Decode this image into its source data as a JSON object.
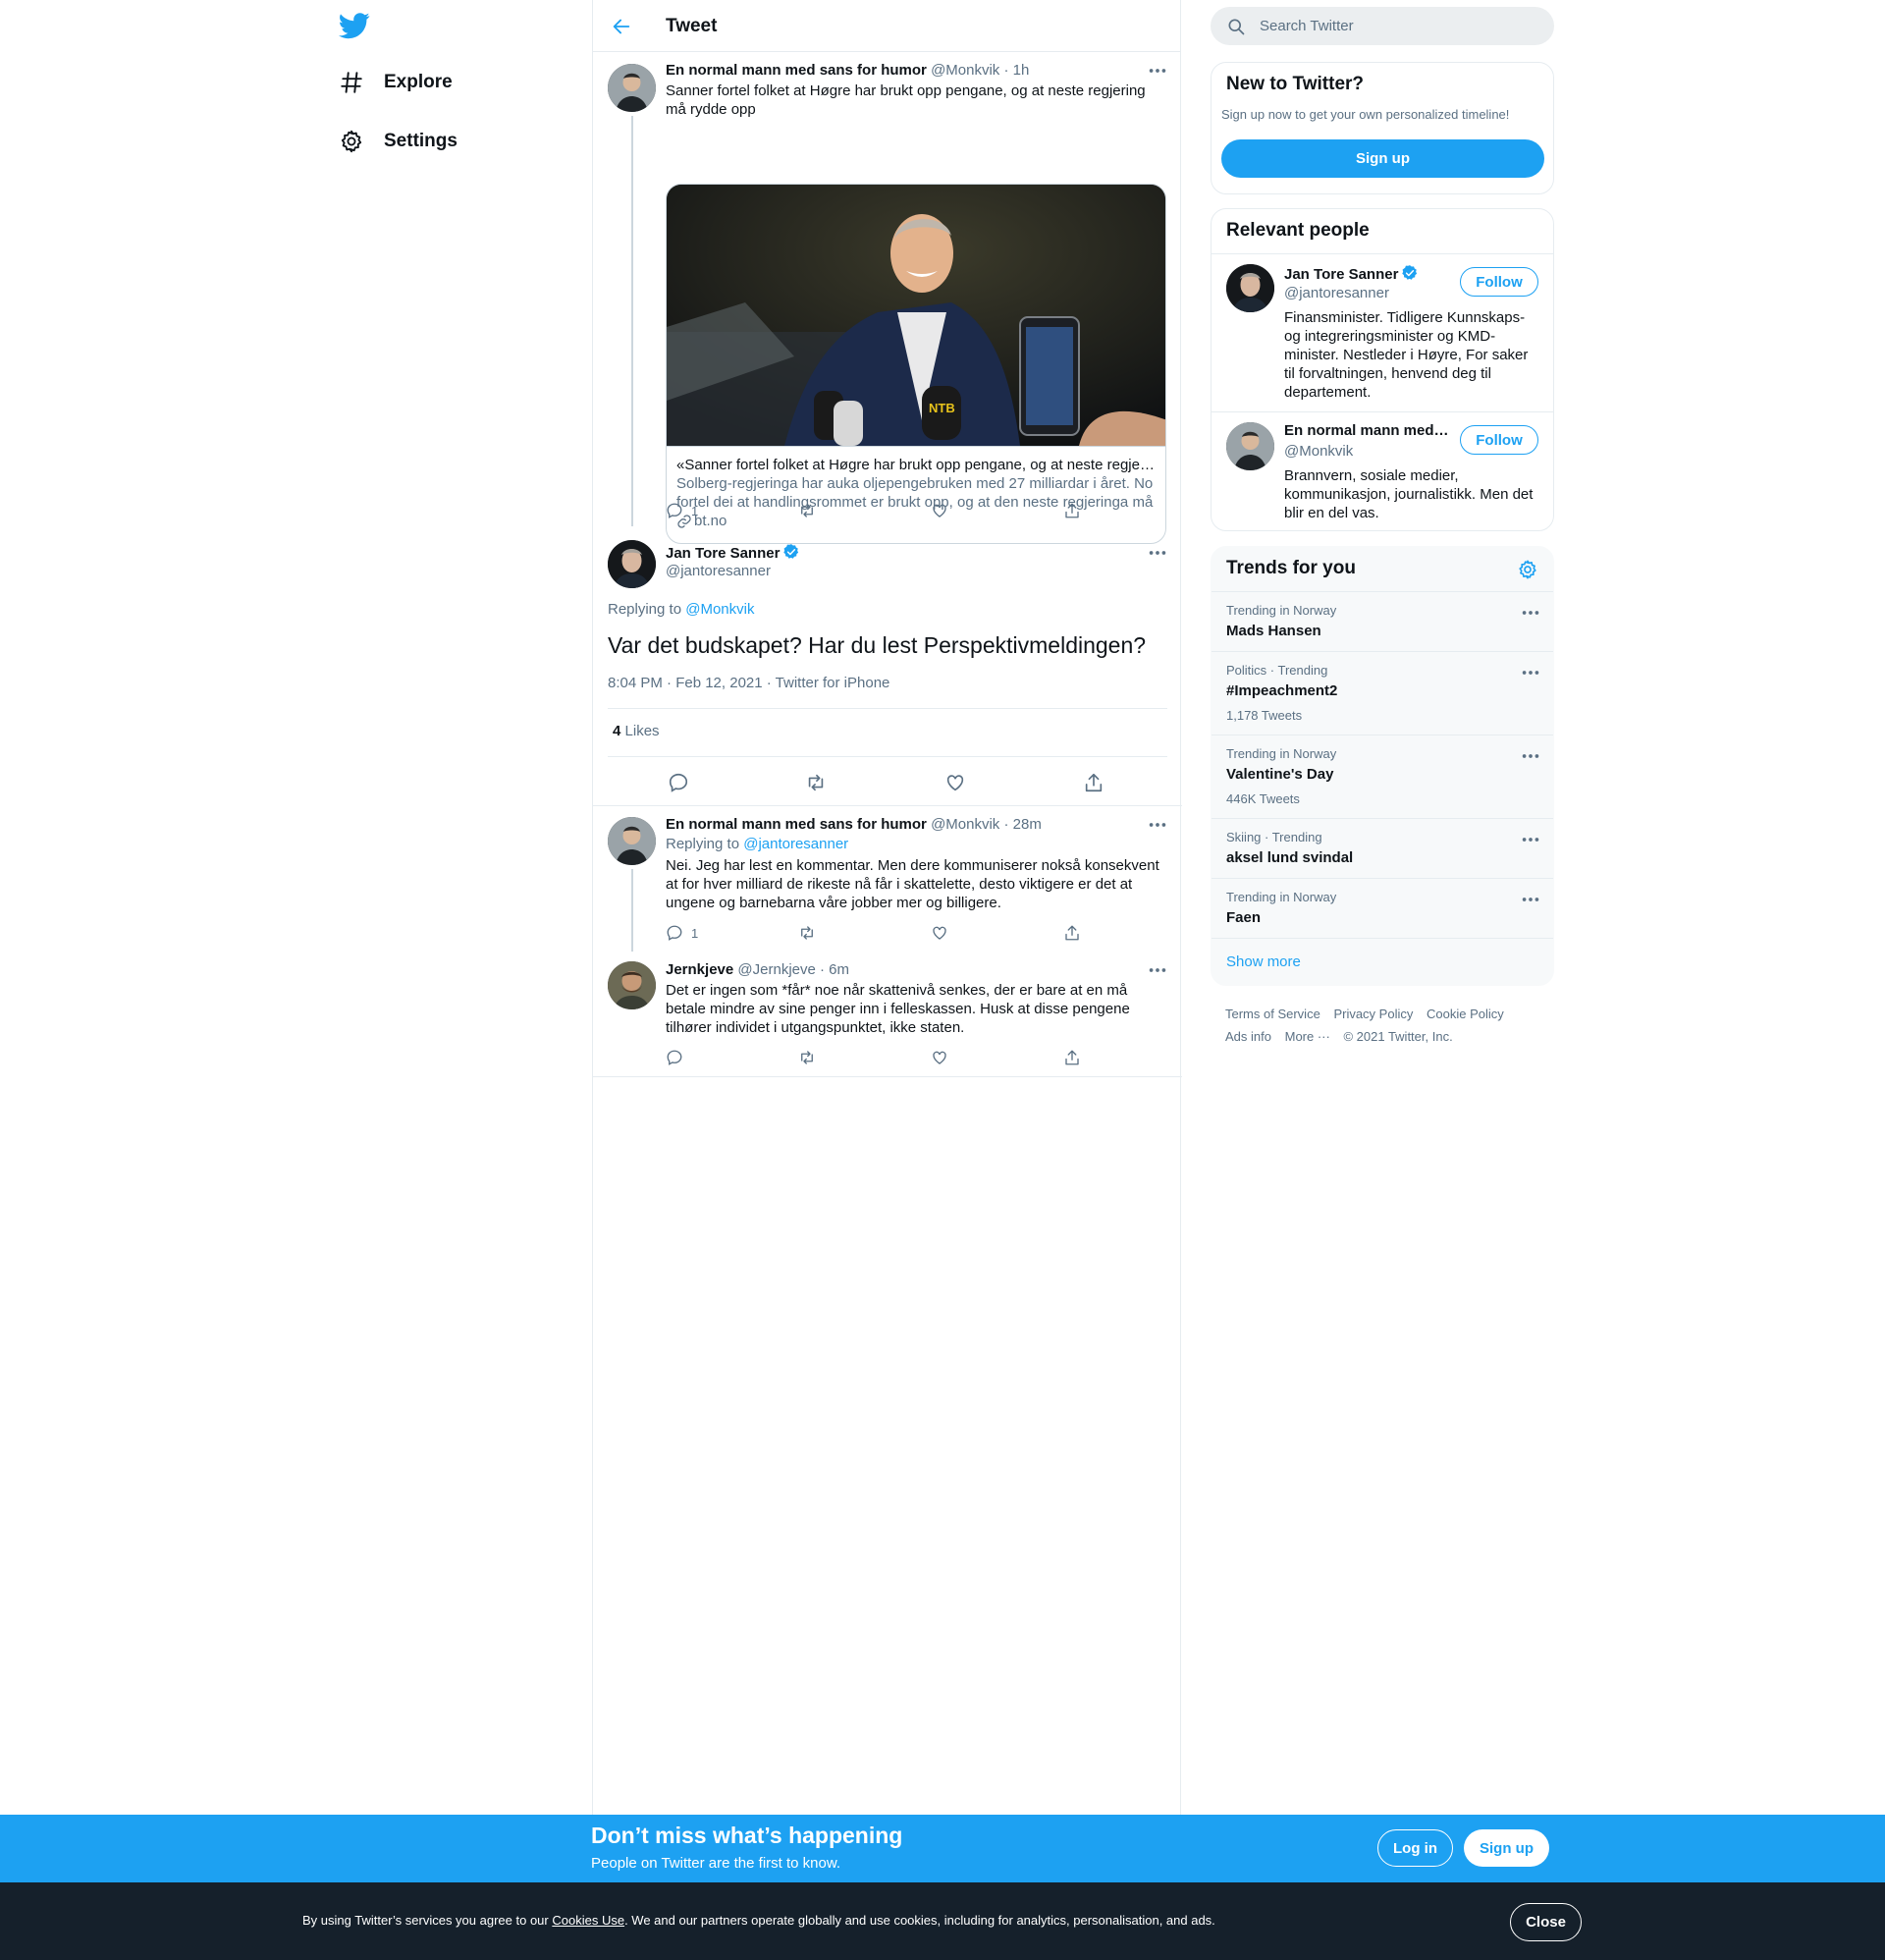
{
  "nav": {
    "explore_label": "Explore",
    "settings_label": "Settings"
  },
  "header": {
    "title": "Tweet"
  },
  "tweets": {
    "parent": {
      "name": "En normal mann med sans for humor",
      "handle": "@Monkvik",
      "time": "· 1h",
      "text": "Sanner fortel folket at Høgre har brukt opp pengane, og at neste regjering må rydde opp",
      "card": {
        "title": "«Sanner fortel folket at Høgre har brukt opp pengane, og at neste regjeringa må rydde opp»",
        "description": "Solberg-regjeringa har auka oljepengebruken med 27 milliardar i året. No fortel dei at handlingsrommet er brukt opp, og at den neste regjeringa må rydde opp.",
        "domain": "bt.no"
      },
      "reply_count": "1"
    },
    "focal": {
      "name": "Jan Tore Sanner",
      "handle": "@jantoresanner",
      "replying_prefix": "Replying to",
      "replying_to": "@Monkvik",
      "text": "Var det budskapet? Har du lest Perspektivmeldingen?",
      "meta": "8:04 PM · Feb 12, 2021 · Twitter for iPhone",
      "likes_count": "4",
      "likes_label": "Likes"
    },
    "reply1": {
      "name": "En normal mann med sans for humor",
      "handle": "@Monkvik",
      "time": "· 28m",
      "replying_prefix": "Replying to",
      "replying_to": "@jantoresanner",
      "text": "Nei. Jeg har lest en kommentar. Men  dere kommuniserer nokså konsekvent at for hver milliard de rikeste nå får i skattelette, desto viktigere er det at ungene og barnebarna våre jobber mer og billigere.",
      "reply_count": "1"
    },
    "reply2": {
      "name": "Jernkjeve",
      "handle": "@Jernkjeve",
      "time": "· 6m",
      "text": "Det er ingen som *får* noe når skattenivå senkes, der er bare at en må betale mindre av sine penger inn i felleskassen. Husk at disse pengene tilhører individet i utgangspunktet, ikke staten."
    }
  },
  "sidebar": {
    "search_placeholder": "Search Twitter",
    "new_to_twitter": {
      "title": "New to Twitter?",
      "subtitle": "Sign up now to get your own personalized timeline!",
      "signup_label": "Sign up"
    },
    "relevant_people": {
      "title": "Relevant people",
      "people": [
        {
          "name": "Jan Tore Sanner",
          "handle": "@jantoresanner",
          "bio": "Finansminister. Tidligere Kunnskaps- og integreringsminister og KMD-minister. Nestleder i Høyre, For saker til forvaltningen, henvend deg til departement.",
          "follow_label": "Follow"
        },
        {
          "name": "En normal mann med…",
          "handle": "@Monkvik",
          "bio": "Brannvern, sosiale medier, kommunikasjon, journalistikk. Men det blir en del vas.",
          "follow_label": "Follow"
        }
      ]
    },
    "trends": {
      "title": "Trends for you",
      "items": [
        {
          "context": "Trending in Norway",
          "name": "Mads Hansen",
          "count": ""
        },
        {
          "context": "Politics · Trending",
          "name": "#Impeachment2",
          "count": "1,178 Tweets"
        },
        {
          "context": "Trending in Norway",
          "name": "Valentine's Day",
          "count": "446K Tweets"
        },
        {
          "context": "Skiing · Trending",
          "name": "aksel lund svindal",
          "count": ""
        },
        {
          "context": "Trending in Norway",
          "name": "Faen",
          "count": ""
        }
      ],
      "show_more": "Show more"
    },
    "footer": {
      "terms": "Terms of Service",
      "privacy": "Privacy Policy",
      "cookie": "Cookie Policy",
      "ads": "Ads info",
      "more": "More ···",
      "copyright": "© 2021 Twitter, Inc."
    }
  },
  "signup_bar": {
    "title": "Don’t miss what’s happening",
    "subtitle": "People on Twitter are the first to know.",
    "login_label": "Log in",
    "signup_label": "Sign up"
  },
  "cookie_bar": {
    "text_before": "By using Twitter’s services you agree to our ",
    "link": "Cookies Use",
    "text_after": ". We and our partners operate globally and use cookies, including for analytics, personalisation, and ads.",
    "close_label": "Close"
  },
  "colors": {
    "accent": "#1da1f2",
    "text": "#0f1419",
    "muted": "#5b7083",
    "cookie_bg": "#15202b"
  }
}
